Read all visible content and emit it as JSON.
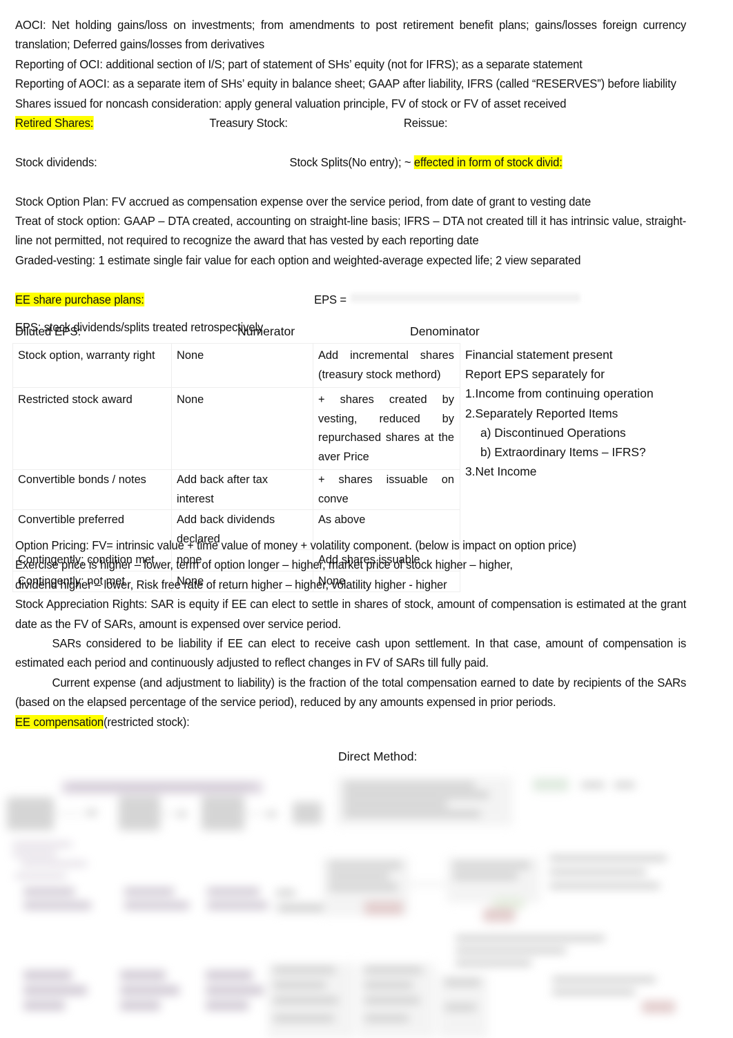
{
  "document": {
    "paragraphs": [
      "AOCI: Net holding gains/loss on investments; from amendments to post retirement benefit plans; gains/losses foreign currency translation; Deferred gains/losses from derivatives",
      "Reporting of OCI: additional section of I/S; part of statement of SHs’ equity (not for IFRS); as a separate statement",
      "Reporting of AOCI: as a separate item of SHs’ equity in balance sheet; GAAP after liability, IFRS (called “RESERVES”) before liability",
      "Shares issued for noncash consideration: apply general valuation principle, FV of stock or FV of asset received"
    ],
    "share_row": {
      "retired_shares": "Retired Shares:",
      "treasury_stock": "Treasury Stock:",
      "reissue": "Reissue:"
    },
    "dividend_row": {
      "stock_dividends": "Stock dividends:",
      "stock_splits": "Stock Splits(No entry); ~ ",
      "effected_highlight": "effected in form of stock divid:"
    },
    "option_block": [
      "Stock Option Plan: FV accrued as compensation expense over the service period, from date of grant to vesting date",
      "Treat of stock option: GAAP – DTA created, accounting on straight-line basis; IFRS – DTA not created till it has intrinsic value, straight-line not permitted, not required to recognize the award that has vested by each reporting date",
      "Graded-vesting: 1 estimate single fair value for each option and weighted-average expected life; 2 view separated"
    ],
    "ee_row": {
      "ee_share_purchase_plans": "EE share purchase plans:",
      "eps_equals": "EPS ="
    },
    "eps_note": "EPS: stock dividends/splits treated retrospectively",
    "table": {
      "headers": [
        "Diluted EPS:",
        "Numerator",
        "Denominator"
      ],
      "rows": [
        {
          "instrument": "Stock option, warranty right",
          "numerator": "None",
          "denominator": "Add incremental shares (treasury stock methord)"
        },
        {
          "instrument": "Restricted stock award",
          "numerator": "None",
          "denominator": "+ shares created by vesting, reduced by repurchased shares at the aver Price"
        },
        {
          "instrument": "Convertible bonds / notes",
          "numerator": "Add back after tax interest",
          "denominator": "+ shares issuable on conve"
        },
        {
          "instrument": "Convertible preferred",
          "numerator": "Add back dividends declared",
          "denominator": "As above"
        },
        {
          "instrument": "Contingently; condition met",
          "numerator": "none",
          "denominator": "Add shares issuable"
        },
        {
          "instrument": "Contingently; not met",
          "numerator": "None",
          "denominator": "None"
        }
      ]
    },
    "side_list": [
      "Financial statement present",
      "Report EPS separately for",
      "1.Income from continuing operation",
      "2.Separately Reported Items",
      "a) Discontinued Operations",
      "b) Extraordinary Items – IFRS?",
      "3.Net Income"
    ],
    "pricing_block": [
      "Option Pricing: FV= intrinsic value + time value of money + volatility component. (below is impact on option price)",
      "Exercise price is higher – lower, term of option longer – higher, market price of stock higher – higher,",
      "dividend higher – lower, Risk free rate of return higher – higher, volatility higher - higher",
      "Stock Appreciation Rights: SAR is equity if EE can elect to settle in shares of stock, amount of compensation is estimated at the grant date as the FV of SARs, amount is expensed over service period.",
      "SARs considered to be liability if EE can elect to receive cash upon settlement. In that case, amount of compensation is estimated each period and continuously adjusted to reflect changes in FV of SARs till fully paid.",
      "Current expense (and adjustment to liability) is the fraction of the total compensation earned to date by recipients of the SARs (based on the elapsed percentage of the service period), reduced by any amounts expensed in prior periods."
    ],
    "ee_compensation": {
      "highlight": "EE compensation",
      "rest": "(restricted stock):"
    },
    "direct_method": "Direct Method:",
    "colors": {
      "highlight": "#ffff00",
      "text": "#111111",
      "table_border": "#eeeeee",
      "page_background": "#ffffff"
    }
  }
}
